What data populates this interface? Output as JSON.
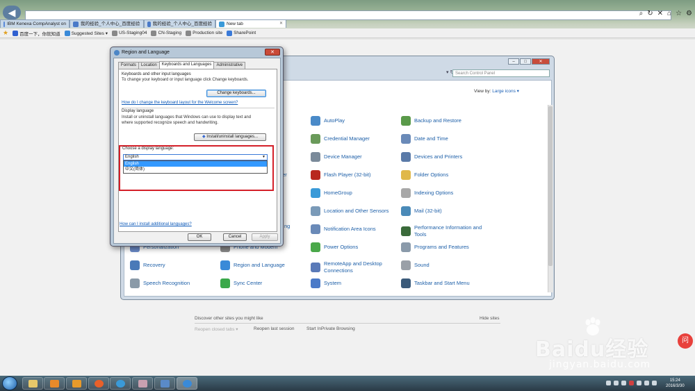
{
  "browser": {
    "tabs": [
      {
        "label": "IBM Kenexa CompAnalyst on"
      },
      {
        "label": "我的经验_个人中心_百度经验"
      },
      {
        "label": "我的经验_个人中心_百度经验"
      },
      {
        "label": "New tab"
      }
    ],
    "favorites": [
      {
        "label": "百度一下，你就知道"
      },
      {
        "label": "Suggested Sites ▾"
      },
      {
        "label": "US-Staging04"
      },
      {
        "label": "CN-Staging"
      },
      {
        "label": "Production site"
      },
      {
        "label": "SharePoint"
      }
    ]
  },
  "control_panel": {
    "search_placeholder": "Search Control Panel",
    "view_by_label": "View by:",
    "view_by_value": "Large icons ▾",
    "items": [
      {
        "label": "AutoPlay",
        "color": "#4a8ac8"
      },
      {
        "label": "Backup and Restore",
        "color": "#5a9a4a"
      },
      {
        "label": "Credential Manager",
        "color": "#6a9a5a"
      },
      {
        "label": "Date and Time",
        "color": "#6a8ab8"
      },
      {
        "label": "Device Manager",
        "color": "#7a8a9a"
      },
      {
        "label": "Devices and Printers",
        "color": "#5a7aa8"
      },
      {
        "label": "Flash Player (32-bit)",
        "color": "#b8281e"
      },
      {
        "label": "Folder Options",
        "color": "#e0b84a"
      },
      {
        "label": "HomeGroup",
        "color": "#3a9ad8"
      },
      {
        "label": "Indexing Options",
        "color": "#a8a8a8"
      },
      {
        "label": "Location and Other Sensors",
        "color": "#7a9ab8"
      },
      {
        "label": "Mail (32-bit)",
        "color": "#4a8ab8"
      },
      {
        "label": "Notification Area Icons",
        "color": "#6a8ab8"
      },
      {
        "label": "Performance Information and Tools",
        "color": "#3a6a3a"
      },
      {
        "label": "Personalization",
        "color": "#6a8ac8"
      },
      {
        "label": "Phone and Modem",
        "color": "#8a8a8a"
      },
      {
        "label": "Power Options",
        "color": "#4aa84a"
      },
      {
        "label": "Programs and Features",
        "color": "#8a9aaa"
      },
      {
        "label": "Recovery",
        "color": "#4a7ab8"
      },
      {
        "label": "Region and Language",
        "color": "#3a8ad8"
      },
      {
        "label": "RemoteApp and Desktop Connections",
        "color": "#5a7ab8"
      },
      {
        "label": "Sound",
        "color": "#9aa0a8"
      },
      {
        "label": "Speech Recognition",
        "color": "#8a9aa8"
      },
      {
        "label": "Sync Center",
        "color": "#3aa84a"
      },
      {
        "label": "System",
        "color": "#4a7ac8"
      },
      {
        "label": "Taskbar and Start Menu",
        "color": "#3a5a7a"
      }
    ],
    "partial_labels": [
      "ls",
      "ter",
      "ng"
    ]
  },
  "dialog": {
    "title": "Region and Language",
    "tabs": [
      "Formats",
      "Location",
      "Keyboards and Languages",
      "Administrative"
    ],
    "active_tab": "Keyboards and Languages",
    "kb_group_title": "Keyboards and other input languages",
    "kb_group_text": "To change your keyboard or input language click Change keyboards.",
    "change_keyboards_btn": "Change keyboards...",
    "kb_link": "How do I change the keyboard layout for the Welcome screen?",
    "display_group_title": "Display language",
    "display_group_text": "Install or uninstall languages that Windows can use to display text and where supported recognize speech and handwriting.",
    "install_btn": "Install/uninstall languages...",
    "choose_label": "Choose a display language:",
    "combo_value": "English",
    "options": [
      "English",
      "中文(简体)"
    ],
    "install_link": "How can I install additional languages?",
    "ok": "OK",
    "cancel": "Cancel",
    "apply": "Apply"
  },
  "newtab": {
    "discover": "Discover other sites you might like",
    "hide": "Hide sites",
    "reopen_closed": "Reopen closed tabs ▾",
    "reopen_last": "Reopen last session",
    "inprivate": "Start InPrivate Browsing"
  },
  "taskbar": {
    "time": "15:24",
    "date": "2016/3/30"
  },
  "watermark": {
    "brand": "Baidu经验",
    "url": "jingyan.baidu.com"
  }
}
